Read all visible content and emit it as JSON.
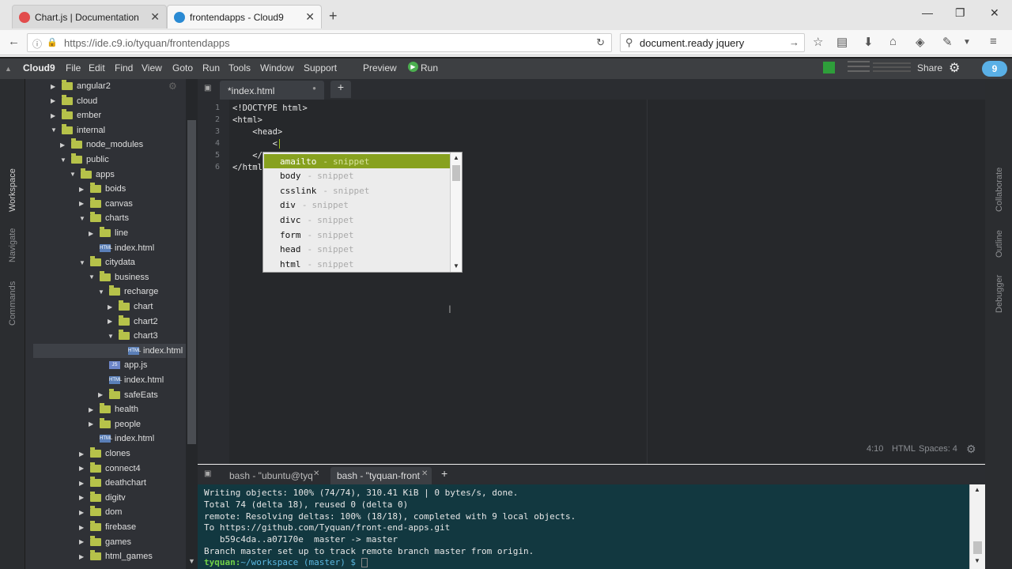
{
  "browser": {
    "tabs": [
      {
        "title": "Chart.js | Documentation"
      },
      {
        "title": "frontendapps - Cloud9"
      }
    ],
    "new_tab": "+",
    "url": "https://ide.c9.io/tyquan/frontendapps",
    "search": "document.ready jquery",
    "window_controls": [
      "—",
      "❐",
      "✕"
    ]
  },
  "c9": {
    "brand": "Cloud9",
    "menu": [
      "File",
      "Edit",
      "Find",
      "View",
      "Goto",
      "Run",
      "Tools",
      "Window",
      "Support"
    ],
    "preview": "Preview",
    "run": "Run",
    "share": "Share",
    "badge": "9",
    "left_panels": [
      "Workspace",
      "Navigate",
      "Commands"
    ],
    "right_panels": [
      "Collaborate",
      "Outline",
      "Debugger"
    ]
  },
  "tree": [
    {
      "label": "angular2",
      "type": "folder",
      "depth": 0,
      "state": "closed"
    },
    {
      "label": "cloud",
      "type": "folder",
      "depth": 0,
      "state": "closed"
    },
    {
      "label": "ember",
      "type": "folder",
      "depth": 0,
      "state": "closed"
    },
    {
      "label": "internal",
      "type": "folder",
      "depth": 0,
      "state": "open"
    },
    {
      "label": "node_modules",
      "type": "folder",
      "depth": 1,
      "state": "closed"
    },
    {
      "label": "public",
      "type": "folder",
      "depth": 1,
      "state": "open"
    },
    {
      "label": "apps",
      "type": "folder",
      "depth": 2,
      "state": "open"
    },
    {
      "label": "boids",
      "type": "folder",
      "depth": 3,
      "state": "closed"
    },
    {
      "label": "canvas",
      "type": "folder",
      "depth": 3,
      "state": "closed"
    },
    {
      "label": "charts",
      "type": "folder",
      "depth": 3,
      "state": "open"
    },
    {
      "label": "line",
      "type": "folder",
      "depth": 4,
      "state": "closed"
    },
    {
      "label": "index.html",
      "type": "file",
      "depth": 4
    },
    {
      "label": "citydata",
      "type": "folder",
      "depth": 3,
      "state": "open"
    },
    {
      "label": "business",
      "type": "folder",
      "depth": 4,
      "state": "open"
    },
    {
      "label": "recharge",
      "type": "folder",
      "depth": 5,
      "state": "open"
    },
    {
      "label": "chart",
      "type": "folder",
      "depth": 6,
      "state": "closed"
    },
    {
      "label": "chart2",
      "type": "folder",
      "depth": 6,
      "state": "closed"
    },
    {
      "label": "chart3",
      "type": "folder",
      "depth": 6,
      "state": "open"
    },
    {
      "label": "index.html",
      "type": "file",
      "depth": 7,
      "selected": true
    },
    {
      "label": "app.js",
      "type": "jsfile",
      "depth": 5
    },
    {
      "label": "index.html",
      "type": "file",
      "depth": 5
    },
    {
      "label": "safeEats",
      "type": "folder",
      "depth": 5,
      "state": "closed"
    },
    {
      "label": "health",
      "type": "folder",
      "depth": 4,
      "state": "closed"
    },
    {
      "label": "people",
      "type": "folder",
      "depth": 4,
      "state": "closed"
    },
    {
      "label": "index.html",
      "type": "file",
      "depth": 4
    },
    {
      "label": "clones",
      "type": "folder",
      "depth": 3,
      "state": "closed"
    },
    {
      "label": "connect4",
      "type": "folder",
      "depth": 3,
      "state": "closed"
    },
    {
      "label": "deathchart",
      "type": "folder",
      "depth": 3,
      "state": "closed"
    },
    {
      "label": "digitv",
      "type": "folder",
      "depth": 3,
      "state": "closed"
    },
    {
      "label": "dom",
      "type": "folder",
      "depth": 3,
      "state": "closed"
    },
    {
      "label": "firebase",
      "type": "folder",
      "depth": 3,
      "state": "closed"
    },
    {
      "label": "games",
      "type": "folder",
      "depth": 3,
      "state": "closed"
    },
    {
      "label": "html_games",
      "type": "folder",
      "depth": 3,
      "state": "closed"
    }
  ],
  "editor": {
    "tab": "*index.html",
    "lines": [
      "<!DOCTYPE html>",
      "<html>",
      "    <head>",
      "        <",
      "    </",
      "</html>"
    ],
    "line_numbers": [
      "1",
      "2",
      "3",
      "4",
      "5",
      "6"
    ],
    "status": {
      "pos": "4:10",
      "mode": "HTML",
      "spaces": "Spaces: 4"
    }
  },
  "autocomplete": [
    {
      "name": "amailto",
      "meta": "snippet",
      "selected": true
    },
    {
      "name": "body",
      "meta": "snippet"
    },
    {
      "name": "csslink",
      "meta": "snippet"
    },
    {
      "name": "div",
      "meta": "snippet"
    },
    {
      "name": "divc",
      "meta": "snippet"
    },
    {
      "name": "form",
      "meta": "snippet"
    },
    {
      "name": "head",
      "meta": "snippet"
    },
    {
      "name": "html",
      "meta": "snippet"
    }
  ],
  "terminal": {
    "tabs": [
      "bash - \"ubuntu@tyq",
      "bash - \"tyquan-front"
    ],
    "lines": [
      "Writing objects: 100% (74/74), 310.41 KiB | 0 bytes/s, done.",
      "Total 74 (delta 18), reused 0 (delta 0)",
      "remote: Resolving deltas: 100% (18/18), completed with 9 local objects.",
      "To https://github.com/Tyquan/front-end-apps.git",
      "   b59c4da..a07170e  master -> master",
      "Branch master set up to track remote branch master from origin."
    ],
    "prompt_user": "tyquan:",
    "prompt_path": "~/workspace (master) $"
  },
  "colors": {
    "accent": "#87a11f",
    "folder": "#b6c24a",
    "terminal_bg": "#123840"
  }
}
